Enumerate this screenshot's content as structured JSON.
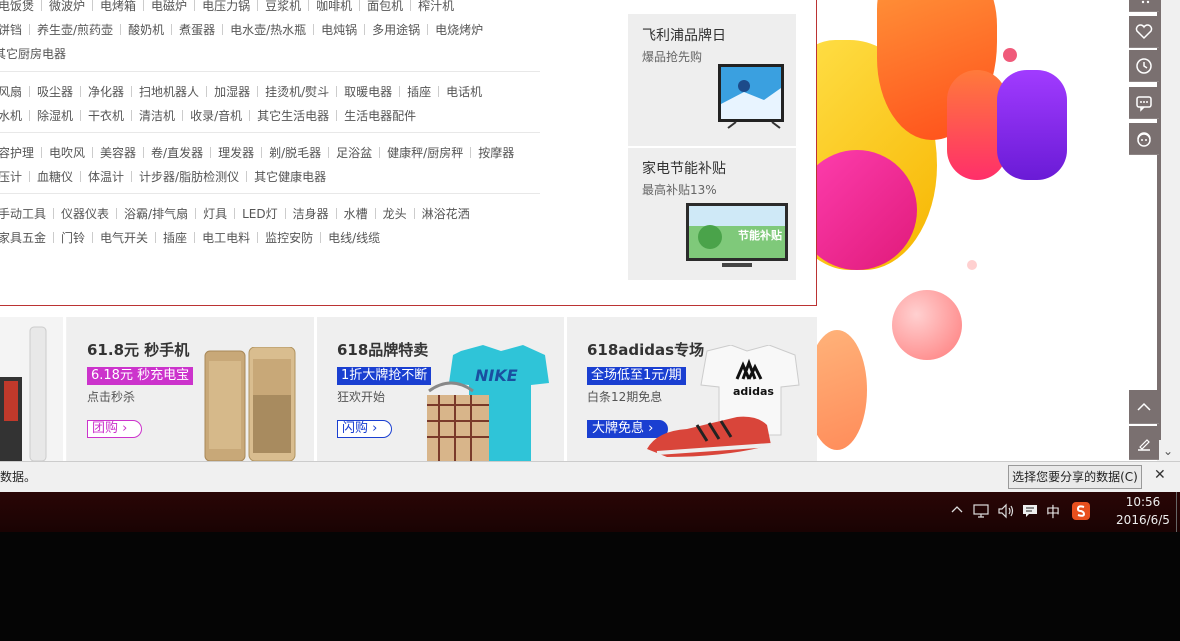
{
  "categories": {
    "group1": {
      "row1": [
        "电饭煲",
        "微波炉",
        "电烤箱",
        "电磁炉",
        "电压力锅",
        "豆浆机",
        "咖啡机",
        "面包机",
        "榨汁机"
      ],
      "row2": [
        "饼铛",
        "养生壶/煎药壶",
        "酸奶机",
        "煮蛋器",
        "电水壶/热水瓶",
        "电炖锅",
        "多用途锅",
        "电烧烤炉"
      ],
      "row3": [
        "其它厨房电器"
      ]
    },
    "group2": {
      "row1": [
        "风扇",
        "吸尘器",
        "净化器",
        "扫地机器人",
        "加湿器",
        "挂烫机/熨斗",
        "取暖电器",
        "插座",
        "电话机"
      ],
      "row2": [
        "水机",
        "除湿机",
        "干衣机",
        "清洁机",
        "收录/音机",
        "其它生活电器",
        "生活电器配件"
      ]
    },
    "group3": {
      "row1": [
        "容护理",
        "电吹风",
        "美容器",
        "卷/直发器",
        "理发器",
        "剃/脱毛器",
        "足浴盆",
        "健康秤/厨房秤",
        "按摩器"
      ],
      "row2": [
        "压计",
        "血糖仪",
        "体温计",
        "计步器/脂肪检测仪",
        "其它健康电器"
      ]
    },
    "group4": {
      "row1": [
        "手动工具",
        "仪器仪表",
        "浴霸/排气扇",
        "灯具",
        "LED灯",
        "洁身器",
        "水槽",
        "龙头",
        "淋浴花洒"
      ],
      "row2": [
        "家具五金",
        "门铃",
        "电气开关",
        "插座",
        "电工电料",
        "监控安防",
        "电线/线缆"
      ]
    }
  },
  "promos": [
    {
      "title": "飞利浦品牌日",
      "subtitle": "爆品抢先购"
    },
    {
      "title": "家电节能补贴",
      "subtitle": "最高补贴13%",
      "image_text": "节能补贴"
    }
  ],
  "deals": [
    {
      "title": "61.8元 秒手机",
      "tag": "6.18元 秒充电宝",
      "subtitle": "点击秒杀",
      "button": "团购",
      "tag_color": "#cc33cc",
      "button_color": "#cc33cc"
    },
    {
      "title": "618品牌特卖",
      "tag": "1折大牌抢不断",
      "subtitle": "狂欢开始",
      "button": "闪购",
      "tag_color": "#1a3fd1",
      "button_color": "#1a3fd1"
    },
    {
      "title": "618adidas专场",
      "tag": "全场低至1元/期",
      "subtitle": "白条12期免息",
      "button": "大牌免息",
      "tag_color": "#1a3fd1",
      "button_color": "#1a3fd1"
    }
  ],
  "deal_product_text": {
    "nike": "NIKE",
    "adidas": "adidas"
  },
  "side_toolbar": {
    "icons": [
      "cart-icon",
      "heart-icon",
      "history-icon",
      "message-icon",
      "customer-service-icon"
    ],
    "bottom_icons": [
      "back-to-top-icon",
      "feedback-icon"
    ]
  },
  "notify_bar": {
    "message": "数据。",
    "share_button": "选择您要分享的数据(C)",
    "close": "✕"
  },
  "taskbar": {
    "ime": "中",
    "time": "10:56",
    "date": "2016/6/5"
  },
  "colors": {
    "panel_border": "#bb3333",
    "toolbar_bg": "#7a7070",
    "taskbar_top": "#2a0606"
  }
}
